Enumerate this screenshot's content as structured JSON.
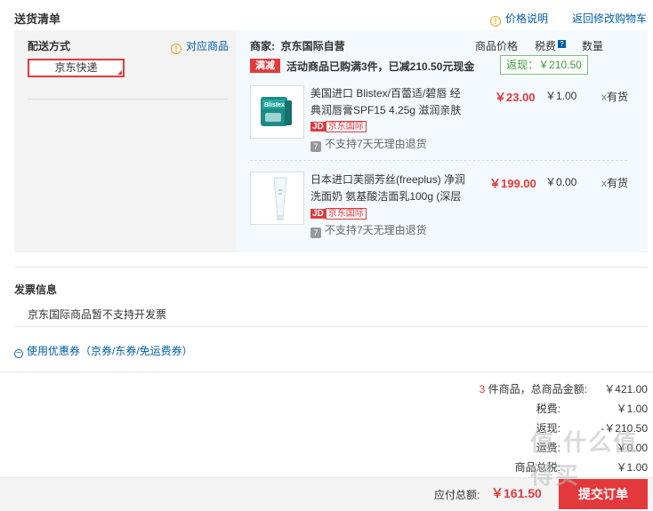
{
  "header": {
    "title": "送货清单",
    "price_note_link": "价格说明",
    "back_to_cart_link": "返回修改购物车"
  },
  "shipping": {
    "label": "配送方式",
    "match_goods_link": "对应商品",
    "selected_method": "京东快递"
  },
  "shop": {
    "seller_label": "商家:",
    "seller_name": "京东国际自营",
    "col_price": "商品价格",
    "col_tax": "税费",
    "col_qty": "数量",
    "promo_tag": "满减",
    "promo_text": "活动商品已购满3件，已减210.50元现金",
    "rebate_text": "返现：￥210.50"
  },
  "items": [
    {
      "name_line1": "美国进口 Blistex/百蕾适/碧唇 经",
      "name_line2": "典润唇膏SPF15 4.25g 滋润亲肤",
      "price": "￥23.00",
      "tax": "￥1.00",
      "stock": "有货",
      "jd_tag": "JD",
      "intl_tag": "京东国际",
      "no_return": "不支持7天无理由退货",
      "thumb_brand": "Blistex"
    },
    {
      "name_line1": "日本进口芙丽芳丝(freeplus) 净润",
      "name_line2": "洗面奶 氨基酸洁面乳100g (深层",
      "price": "￥199.00",
      "tax": "￥0.00",
      "stock": "有货",
      "jd_tag": "JD",
      "intl_tag": "京东国际",
      "no_return": "不支持7天无理由退货",
      "thumb_brand": ""
    }
  ],
  "invoice": {
    "title": "发票信息",
    "note": "京东国际商品暂不支持开发票"
  },
  "coupon": {
    "toggle_text": "使用优惠券（京券/东券/免运费券）"
  },
  "summary": {
    "count": "3",
    "count_suffix": "件商品，总商品金额:",
    "total_goods_value": "￥421.00",
    "tax_label": "税费:",
    "tax_value": "￥1.00",
    "rebate_label": "返现:",
    "rebate_value": "-￥210.50",
    "freight_label": "运费:",
    "freight_value": "￥0.00",
    "tax_total_label": "商品总税:",
    "tax_total_value": "￥1.00"
  },
  "footer": {
    "payable_label": "应付总额:",
    "payable_value": "￥161.50",
    "submit_label": "提交订单"
  },
  "watermark": "值 什么值得买",
  "colors": {
    "accent_red": "#e4393c",
    "link_blue": "#005ea7",
    "rebate_green": "#3a9a3a",
    "panel_blue": "#f3f9fd"
  }
}
